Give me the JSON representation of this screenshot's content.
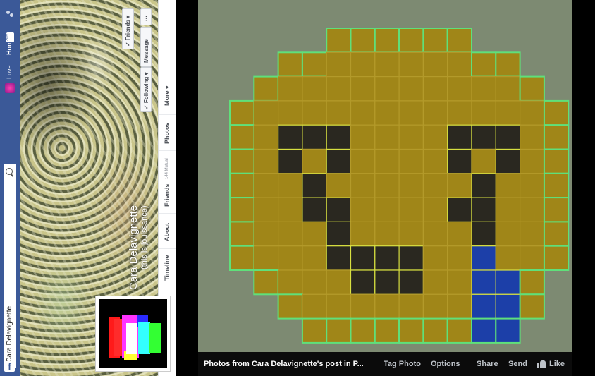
{
  "fb": {
    "logo": "f",
    "search_placeholder": "Cara Delavignette",
    "home_label": "Home",
    "home_count": "20+",
    "love_label": "Love",
    "profile_name": "Cara Delavignette",
    "profile_subname": "(this is jouissance)",
    "buttons": {
      "friends": "✓ Friends ▾",
      "following": "✓ Following ▾",
      "message": "Message",
      "more": "···"
    },
    "tabs": {
      "timeline": "Timeline",
      "about": "About",
      "friends": "Friends",
      "mutual": "144 Mutual",
      "photos": "Photos",
      "more": "More ▾"
    }
  },
  "viewer": {
    "caption": "Photos from Cara Delavignette's post in P...",
    "tag_photo": "Tag Photo",
    "options": "Options",
    "share": "Share",
    "send": "Send",
    "like": "Like"
  },
  "colors": {
    "facebook_blue": "#3b5998",
    "photo_background": "#7d8a72",
    "emoji_face": "#a08618",
    "emoji_dark": "#2a2820",
    "emoji_tongue": "#1c3fa8"
  }
}
